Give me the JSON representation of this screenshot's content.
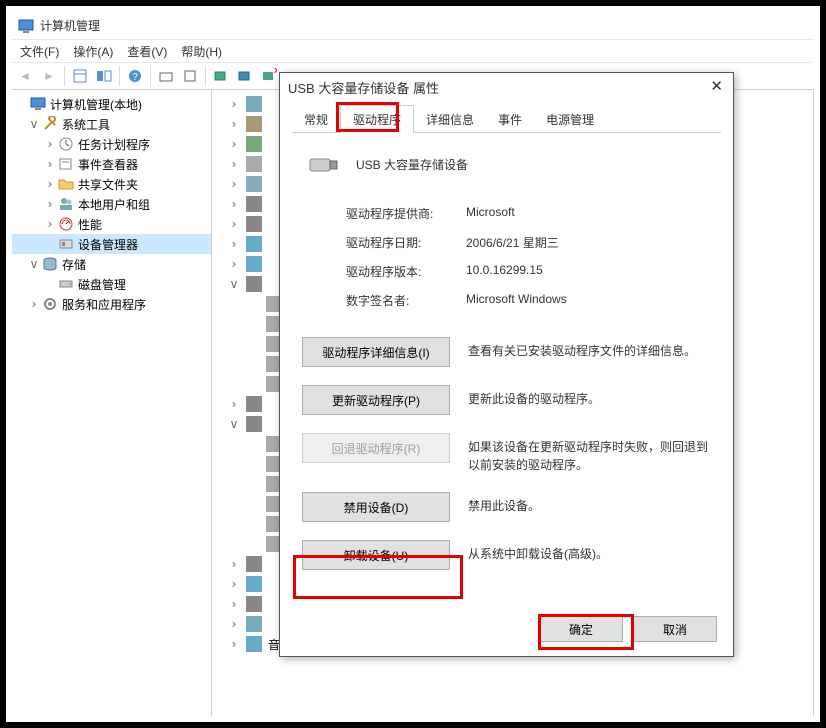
{
  "window_title": "计算机管理",
  "menus": {
    "file": "文件(F)",
    "action": "操作(A)",
    "view": "查看(V)",
    "help": "帮助(H)"
  },
  "tree": {
    "root": "计算机管理(本地)",
    "system_tools": "系统工具",
    "task_scheduler": "任务计划程序",
    "event_viewer": "事件查看器",
    "shared_folders": "共享文件夹",
    "local_users": "本地用户和组",
    "performance": "性能",
    "device_manager": "设备管理器",
    "storage": "存储",
    "disk_mgmt": "磁盘管理",
    "services_apps": "服务和应用程序"
  },
  "center_last": "音频输入和输出",
  "dialog": {
    "title": "USB 大容量存储设备 属性",
    "tabs": {
      "general": "常规",
      "driver": "驱动程序",
      "details": "详细信息",
      "events": "事件",
      "power": "电源管理"
    },
    "device_name": "USB 大容量存储设备",
    "labels": {
      "provider": "驱动程序提供商:",
      "date": "驱动程序日期:",
      "version": "驱动程序版本:",
      "signer": "数字签名者:"
    },
    "values": {
      "provider": "Microsoft",
      "date": "2006/6/21 星期三",
      "version": "10.0.16299.15",
      "signer": "Microsoft Windows"
    },
    "buttons": {
      "details": "驱动程序详细信息(I)",
      "details_desc": "查看有关已安装驱动程序文件的详细信息。",
      "update": "更新驱动程序(P)",
      "update_desc": "更新此设备的驱动程序。",
      "rollback": "回退驱动程序(R)",
      "rollback_desc": "如果该设备在更新驱动程序时失败，则回退到以前安装的驱动程序。",
      "disable": "禁用设备(D)",
      "disable_desc": "禁用此设备。",
      "uninstall": "卸载设备(U)",
      "uninstall_desc": "从系统中卸载设备(高级)。"
    },
    "ok": "确定",
    "cancel": "取消"
  }
}
